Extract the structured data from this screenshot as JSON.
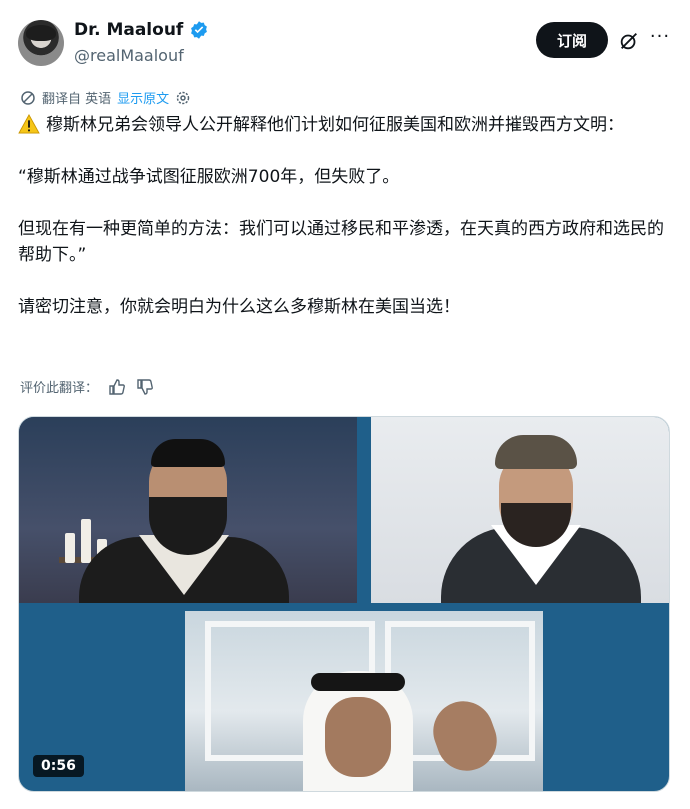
{
  "author": {
    "display_name": "Dr. Maalouf",
    "handle": "@realMaalouf",
    "avatar_icon": "user-avatar"
  },
  "actions": {
    "subscribe_label": "订阅",
    "grok_icon": "grok-icon",
    "more_icon": "more-icon"
  },
  "translation": {
    "translated_from": "翻译自 英语",
    "show_original": "显示原文",
    "rate_label": "评价此翻译："
  },
  "tweet": {
    "line1": "穆斯林兄弟会领导人公开解释他们计划如何征服美国和欧洲并摧毁西方文明：",
    "line2": "“穆斯林通过战争试图征服欧洲700年，但失败了。",
    "line3": "但现在有一种更简单的方法：我们可以通过移民和平渗透，在天真的西方政府和选民的帮助下。”",
    "line4": "请密切注意，你就会明白为什么这么多穆斯林在美国当选！"
  },
  "media": {
    "duration": "0:56"
  },
  "colors": {
    "accent": "#1d9bf0",
    "text": "#0f1419",
    "muted": "#536471",
    "button_bg": "#0f1419"
  }
}
